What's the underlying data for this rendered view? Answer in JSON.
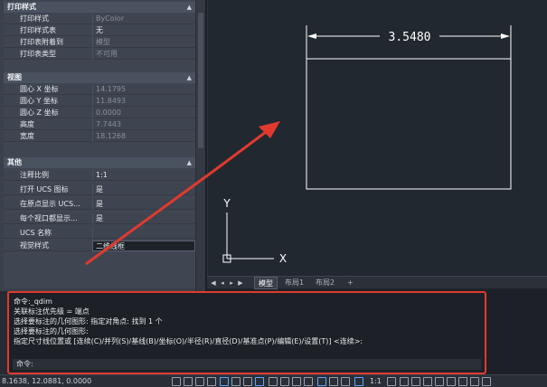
{
  "palette": {
    "sections": [
      {
        "title": "打印样式",
        "rows": [
          {
            "label": "打印样式",
            "value": "ByColor",
            "dim": true
          },
          {
            "label": "打印样式表",
            "value": "无",
            "dim": false
          },
          {
            "label": "打印表附着到",
            "value": "模型",
            "dim": true
          },
          {
            "label": "打印表类型",
            "value": "不可用",
            "dim": true
          }
        ]
      },
      {
        "title": "视图",
        "rows": [
          {
            "label": "圆心 X 坐标",
            "value": "14.1795",
            "dim": true
          },
          {
            "label": "圆心 Y 坐标",
            "value": "11.8493",
            "dim": true
          },
          {
            "label": "圆心 Z 坐标",
            "value": "0.0000",
            "dim": true
          },
          {
            "label": "高度",
            "value": "7.7443",
            "dim": true
          },
          {
            "label": "宽度",
            "value": "18.1268",
            "dim": true
          }
        ]
      },
      {
        "title": "其他",
        "rows": [
          {
            "label": "注释比例",
            "value": "1:1",
            "dim": false
          },
          {
            "label": "打开 UCS 图标",
            "value": "是",
            "dim": false
          },
          {
            "label": "在原点显示 UCS...",
            "value": "是",
            "dim": false
          },
          {
            "label": "每个视口都显示...",
            "value": "是",
            "dim": false
          },
          {
            "label": "UCS 名称",
            "value": "",
            "dim": false
          },
          {
            "label": "视觉样式",
            "value": "二维线框",
            "dim": false
          }
        ]
      }
    ]
  },
  "drawing": {
    "dimension_text": "3.5480",
    "ucs_y": "Y",
    "ucs_x": "X",
    "annotation_color": "#e03a2f"
  },
  "tabs": {
    "items": [
      "模型",
      "布局1",
      "布局2",
      "+"
    ],
    "active": "模型"
  },
  "command": {
    "history": [
      "命令:_qdim",
      "关联标注优先级 = 端点",
      "选择要标注的几何图形: 指定对角点: 找到 1 个",
      "选择要标注的几何图形:",
      "指定尺寸线位置或 [连续(C)/并列(S)/基线(B)/坐标(O)/半径(R)/直径(D)/基准点(P)/编辑(E)/设置(T)] <连续>:"
    ],
    "prompt": "命令:"
  },
  "status": {
    "coords": "8.1638, 12.0881, 0.0000",
    "scale": "1:1"
  }
}
